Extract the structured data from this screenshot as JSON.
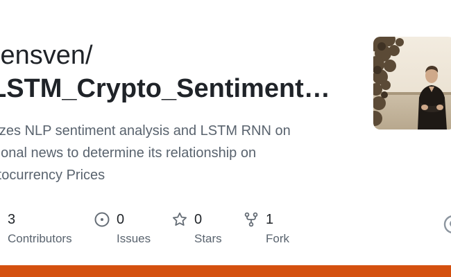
{
  "repo": {
    "owner": "lensven/",
    "name": "LSTM_Crypto_Sentiment…",
    "description_lines": [
      "tilizes NLP sentiment analysis and LSTM RNN on",
      "ational news to determine its relationship on",
      "rytocurrency Prices"
    ]
  },
  "stats": [
    {
      "value": "3",
      "label": "Contributors",
      "icon": "people-icon"
    },
    {
      "value": "0",
      "label": "Issues",
      "icon": "issue-opened-icon"
    },
    {
      "value": "0",
      "label": "Stars",
      "icon": "star-icon"
    },
    {
      "value": "1",
      "label": "Fork",
      "icon": "repo-forked-icon"
    }
  ],
  "avatar": {
    "icon": "owner-avatar"
  },
  "colors": {
    "accent_bar": "#d4500f",
    "text_primary": "#1f2328",
    "text_muted": "#59636e",
    "icon_muted": "#656d76"
  }
}
